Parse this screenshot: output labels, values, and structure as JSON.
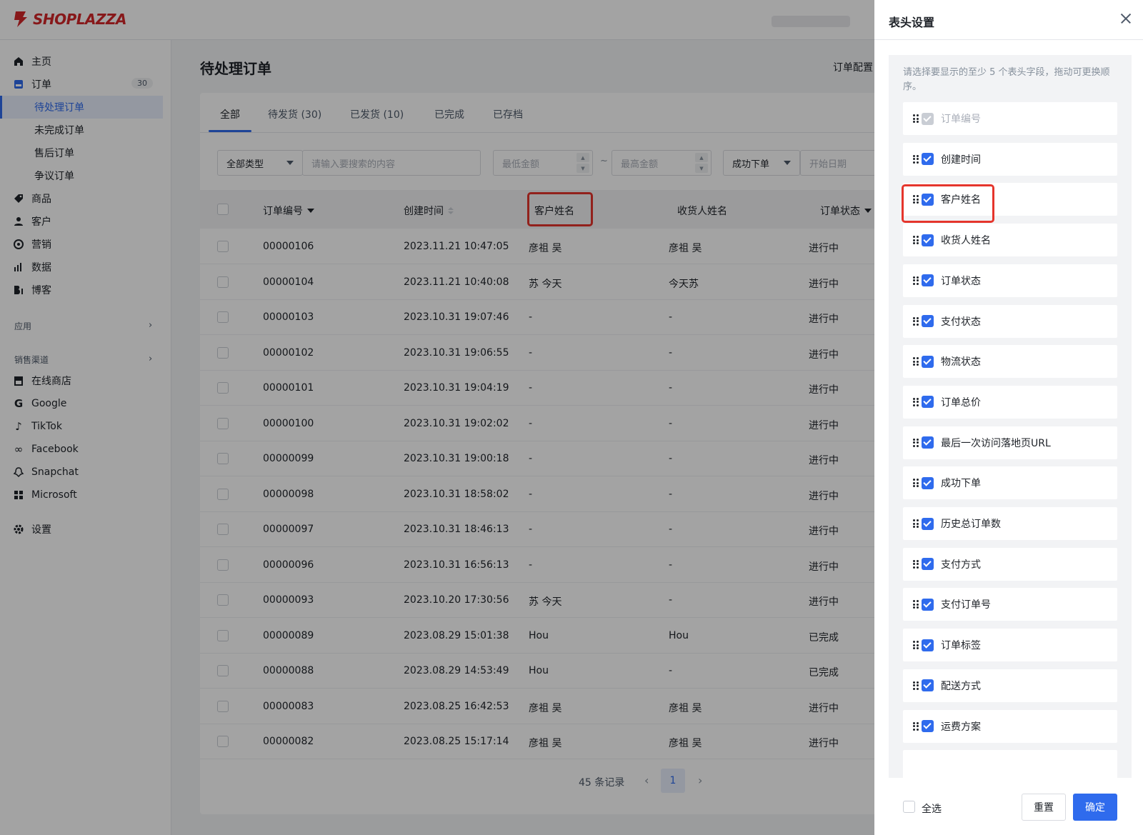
{
  "brand": {
    "name": "SHOPLAZZA",
    "color": "#d4272a",
    "accent": "#2f6bed"
  },
  "sidebar": {
    "items": [
      {
        "label": "主页",
        "icon": "home-icon"
      },
      {
        "label": "订单",
        "icon": "order-icon",
        "badge": "30"
      },
      {
        "label": "待处理订单",
        "active": true
      },
      {
        "label": "未完成订单"
      },
      {
        "label": "售后订单"
      },
      {
        "label": "争议订单"
      },
      {
        "label": "商品",
        "icon": "tag-icon"
      },
      {
        "label": "客户",
        "icon": "user-icon"
      },
      {
        "label": "营销",
        "icon": "marketing-icon"
      },
      {
        "label": "数据",
        "icon": "chart-icon"
      },
      {
        "label": "博客",
        "icon": "blog-icon"
      }
    ],
    "section_apps": "应用",
    "section_channels": "销售渠道",
    "channels": [
      {
        "label": "在线商店",
        "icon": "store-icon"
      },
      {
        "label": "Google",
        "icon": "google-icon"
      },
      {
        "label": "TikTok",
        "icon": "tiktok-icon"
      },
      {
        "label": "Facebook",
        "icon": "facebook-icon"
      },
      {
        "label": "Snapchat",
        "icon": "snapchat-icon"
      },
      {
        "label": "Microsoft",
        "icon": "microsoft-icon"
      }
    ],
    "settings": {
      "label": "设置",
      "icon": "gear-icon"
    }
  },
  "main": {
    "title": "待处理订单",
    "order_config": "订单配置",
    "tabs": [
      "全部",
      "待发货 (30)",
      "已发货 (10)",
      "已完成",
      "已存档"
    ],
    "filters": {
      "type": "全部类型",
      "search_placeholder": "请输入要搜索的内容",
      "min_amount": "最低金额",
      "range_sep": "~",
      "max_amount": "最高金额",
      "status": "成功下单",
      "start_date": "开始日期"
    },
    "columns": [
      "订单编号",
      "创建时间",
      "客户姓名",
      "收货人姓名",
      "订单状态"
    ],
    "rows": [
      {
        "id": "00000106",
        "time": "2023.11.21 10:47:05",
        "customer": "彦祖 吴",
        "receiver": "彦祖 吴",
        "status": "进行中"
      },
      {
        "id": "00000104",
        "time": "2023.11.21 10:40:08",
        "customer": "苏 今天",
        "receiver": "今天苏",
        "status": "进行中"
      },
      {
        "id": "00000103",
        "time": "2023.10.31 19:07:46",
        "customer": "-",
        "receiver": "-",
        "status": "进行中"
      },
      {
        "id": "00000102",
        "time": "2023.10.31 19:06:55",
        "customer": "-",
        "receiver": "-",
        "status": "进行中"
      },
      {
        "id": "00000101",
        "time": "2023.10.31 19:04:19",
        "customer": "-",
        "receiver": "-",
        "status": "进行中"
      },
      {
        "id": "00000100",
        "time": "2023.10.31 19:02:02",
        "customer": "-",
        "receiver": "-",
        "status": "进行中"
      },
      {
        "id": "00000099",
        "time": "2023.10.31 19:00:18",
        "customer": "-",
        "receiver": "-",
        "status": "进行中"
      },
      {
        "id": "00000098",
        "time": "2023.10.31 18:58:02",
        "customer": "-",
        "receiver": "-",
        "status": "进行中"
      },
      {
        "id": "00000097",
        "time": "2023.10.31 18:46:13",
        "customer": "-",
        "receiver": "-",
        "status": "进行中"
      },
      {
        "id": "00000096",
        "time": "2023.10.31 16:56:13",
        "customer": "-",
        "receiver": "-",
        "status": "进行中"
      },
      {
        "id": "00000093",
        "time": "2023.10.20 17:30:56",
        "customer": "苏 今天",
        "receiver": "-",
        "status": "进行中"
      },
      {
        "id": "00000089",
        "time": "2023.08.29 15:01:38",
        "customer": "Hou",
        "receiver": "Hou",
        "status": "已完成"
      },
      {
        "id": "00000088",
        "time": "2023.08.29 14:53:49",
        "customer": "Hou",
        "receiver": "-",
        "status": "已完成"
      },
      {
        "id": "00000083",
        "time": "2023.08.25 16:42:53",
        "customer": "彦祖 吴",
        "receiver": "彦祖 吴",
        "status": "进行中"
      },
      {
        "id": "00000082",
        "time": "2023.08.25 15:17:14",
        "customer": "彦祖 吴",
        "receiver": "彦祖 吴",
        "status": "进行中"
      }
    ],
    "pagination": {
      "total": "45 条记录",
      "page": "1"
    }
  },
  "drawer": {
    "title": "表头设置",
    "hint": "请选择要显示的至少 5 个表头字段，拖动可更换顺序。",
    "fields": [
      {
        "label": "订单编号",
        "checked": true,
        "disabled": true
      },
      {
        "label": "创建时间",
        "checked": true
      },
      {
        "label": "客户姓名",
        "checked": true
      },
      {
        "label": "收货人姓名",
        "checked": true
      },
      {
        "label": "订单状态",
        "checked": true
      },
      {
        "label": "支付状态",
        "checked": true
      },
      {
        "label": "物流状态",
        "checked": true
      },
      {
        "label": "订单总价",
        "checked": true
      },
      {
        "label": "最后一次访问落地页URL",
        "checked": true
      },
      {
        "label": "成功下单",
        "checked": true
      },
      {
        "label": "历史总订单数",
        "checked": true
      },
      {
        "label": "支付方式",
        "checked": true
      },
      {
        "label": "支付订单号",
        "checked": true
      },
      {
        "label": "订单标签",
        "checked": true
      },
      {
        "label": "配送方式",
        "checked": true
      },
      {
        "label": "运费方案",
        "checked": true
      }
    ],
    "select_all": "全选",
    "reset": "重置",
    "confirm": "确定"
  }
}
